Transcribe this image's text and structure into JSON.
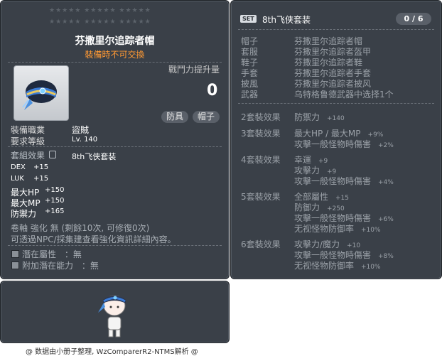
{
  "item_id": "01004232",
  "star_rows": [
    "★★★★★ ★★★★★ ★★★★★",
    "★★★★★ ★★★★★ ★★★★★"
  ],
  "item": {
    "name": "芬撒里尔追踪者帽",
    "trade_note": "裝備時不可交換",
    "icon": "hat-icon",
    "power_label": "戰鬥力提升量",
    "power_value": "0",
    "tags": [
      "防具",
      "帽子"
    ]
  },
  "requirements": [
    {
      "key": "裝備職業",
      "value": "盜賊"
    },
    {
      "key": "要求等級",
      "value": "Lv. 140"
    }
  ],
  "set_effect_label": "套組效果",
  "set_effect_value": "8th飞侠套装",
  "stats": [
    {
      "key": "DEX",
      "value": "+15"
    },
    {
      "key": "LUK",
      "value": "+15"
    },
    {
      "key": "最大HP",
      "value": "+150"
    },
    {
      "key": "最大MP",
      "value": "+150"
    },
    {
      "key": "防禦力",
      "value": "+165"
    }
  ],
  "upgrade_line": "卷軸 強化 無 (剩餘10次, 可修復0次)",
  "info_line": "可透過NPC/採集建查看強化資訊詳細內容。",
  "potentials": [
    {
      "label": "潛在屬性",
      "value": "：無"
    },
    {
      "label": "附加潛在能力",
      "value": "：無"
    }
  ],
  "set": {
    "badge": "SET",
    "name": "8th飞侠套装",
    "count": "0 / 6",
    "pieces": [
      {
        "slot": "帽子",
        "name": "芬撒里尔追踪者帽"
      },
      {
        "slot": "套服",
        "name": "芬撒里尔追踪者盔甲"
      },
      {
        "slot": "鞋子",
        "name": "芬撒里尔追踪者鞋"
      },
      {
        "slot": "手套",
        "name": "芬撒里尔追踪者手套"
      },
      {
        "slot": "披風",
        "name": "芬撒里尔追踪者披风"
      },
      {
        "slot": "武器",
        "name": "乌特格鲁德武器中选择1个"
      }
    ],
    "bonuses": [
      {
        "title": "2套裝效果",
        "lines": [
          {
            "label": "防禦力",
            "value": "+140"
          }
        ]
      },
      {
        "title": "3套裝效果",
        "lines": [
          {
            "label": "最大HP / 最大MP",
            "value": "+9%"
          },
          {
            "label": "攻擊一般怪物時傷害",
            "value": "+2%"
          }
        ]
      },
      {
        "title": "4套裝效果",
        "lines": [
          {
            "label": "幸運",
            "value": "+9"
          },
          {
            "label": "攻擊力",
            "value": "+9"
          },
          {
            "label": "攻擊一般怪物時傷害",
            "value": "+4%"
          }
        ]
      },
      {
        "title": "5套裝效果",
        "lines": [
          {
            "label": "全部屬性",
            "value": "+15"
          },
          {
            "label": "防御力",
            "value": "+250"
          },
          {
            "label": "攻擊一般怪物時傷害",
            "value": "+6%"
          },
          {
            "label": "无视怪物防御率",
            "value": "+10%"
          }
        ]
      },
      {
        "title": "6套裝效果",
        "lines": [
          {
            "label": "攻擊力/魔力",
            "value": "+10"
          },
          {
            "label": "攻擊一般怪物時傷害",
            "value": "+8%"
          },
          {
            "label": "无视怪物防御率",
            "value": "+10%"
          }
        ]
      }
    ]
  },
  "footer": "@ 数据由小册子整理, WzComparerR2-NTMS解析 @",
  "colors": {
    "panel": "#3a4048",
    "name": "#ffffff",
    "trade_note": "#ff9933",
    "muted": "#9ba1a8"
  }
}
